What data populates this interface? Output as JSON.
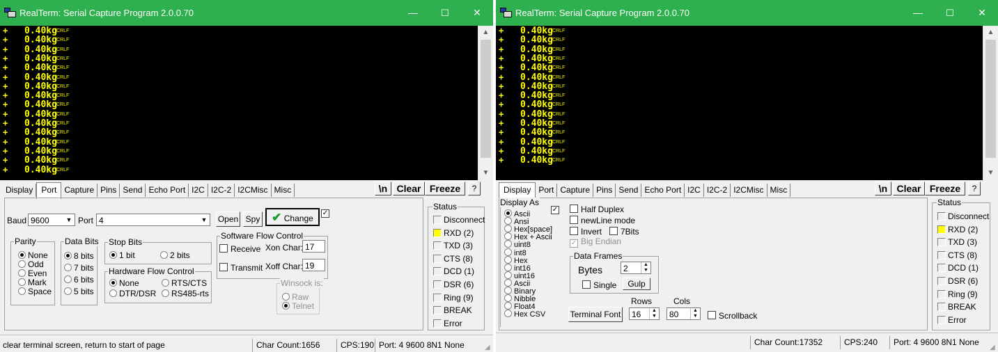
{
  "window_left": {
    "title": "RealTerm: Serial Capture Program 2.0.0.70",
    "controls": {
      "minimize": "—",
      "maximize": "☐",
      "close": "✕"
    },
    "terminal": {
      "plus": "+",
      "value": "0.40kg",
      "crlf": "CRLF",
      "line_count": 16
    },
    "tabs": [
      "Display",
      "Port",
      "Capture",
      "Pins",
      "Send",
      "Echo Port",
      "I2C",
      "I2C-2",
      "I2CMisc",
      "Misc"
    ],
    "active_tab": "Port",
    "right_buttons": {
      "newline": "\\n",
      "clear": "Clear",
      "freeze": "Freeze",
      "help": "?"
    },
    "port": {
      "baud_label": "Baud",
      "baud_value": "9600",
      "port_label": "Port",
      "port_value": "4",
      "open": "Open",
      "spy": "Spy",
      "change": "Change",
      "parity": {
        "title": "Parity",
        "options": [
          "None",
          "Odd",
          "Even",
          "Mark",
          "Space"
        ],
        "selected": "None"
      },
      "data_bits": {
        "title": "Data Bits",
        "options": [
          "8 bits",
          "7 bits",
          "6 bits",
          "5 bits"
        ],
        "selected": "8 bits"
      },
      "stop_bits": {
        "title": "Stop Bits",
        "options": [
          "1 bit",
          "2 bits"
        ],
        "selected": "1 bit"
      },
      "hw_flow": {
        "title": "Hardware Flow Control",
        "options": [
          "None",
          "RTS/CTS",
          "DTR/DSR",
          "RS485-rts"
        ],
        "selected": "None"
      },
      "sw_flow": {
        "title": "Software Flow Control",
        "receive": "Receive",
        "transmit": "Transmit",
        "xon_label": "Xon Char:",
        "xon_value": "17",
        "xoff_label": "Xoff Char:",
        "xoff_value": "19"
      },
      "winsock": {
        "title": "Winsock is:",
        "options": [
          "Raw",
          "Telnet"
        ],
        "selected": "Telnet"
      }
    },
    "status": {
      "title": "Status",
      "items": [
        "Disconnect",
        "RXD (2)",
        "TXD (3)",
        "CTS (8)",
        "DCD (1)",
        "DSR (6)",
        "Ring (9)",
        "BREAK",
        "Error"
      ],
      "lit": "RXD (2)"
    },
    "statusbar": {
      "hint": "clear terminal screen, return to start of page",
      "char_count": "Char Count:1656",
      "cps": "CPS:190",
      "port": "Port: 4 9600 8N1 None"
    }
  },
  "window_right": {
    "title": "RealTerm: Serial Capture Program 2.0.0.70",
    "controls": {
      "minimize": "—",
      "maximize": "☐",
      "close": "✕"
    },
    "terminal": {
      "plus": "+",
      "value": "0.40kg",
      "crlf": "CRLF",
      "line_count": 15
    },
    "tabs": [
      "Display",
      "Port",
      "Capture",
      "Pins",
      "Send",
      "Echo Port",
      "I2C",
      "I2C-2",
      "I2CMisc",
      "Misc"
    ],
    "active_tab": "Display",
    "right_buttons": {
      "newline": "\\n",
      "clear": "Clear",
      "freeze": "Freeze",
      "help": "?"
    },
    "display": {
      "display_as_title": "Display As",
      "display_as_options": [
        "Ascii",
        "Ansi",
        "Hex[space]",
        "Hex + Ascii",
        "uint8",
        "int8",
        "Hex",
        "int16",
        "uint16",
        "Ascii",
        "Binary",
        "Nibble",
        "Float4",
        "Hex CSV"
      ],
      "selected": "Ascii",
      "half_duplex": "Half Duplex",
      "newline_mode": "newLine mode",
      "invert": "Invert",
      "seven_bits": "7Bits",
      "big_endian": "Big Endian",
      "data_frames_title": "Data Frames",
      "bytes_label": "Bytes",
      "bytes_value": "2",
      "single": "Single",
      "gulp": "Gulp",
      "terminal_font": "Terminal Font",
      "rows_label": "Rows",
      "rows_value": "16",
      "cols_label": "Cols",
      "cols_value": "80",
      "scrollback": "Scrollback"
    },
    "status": {
      "title": "Status",
      "items": [
        "Disconnect",
        "RXD (2)",
        "TXD (3)",
        "CTS (8)",
        "DCD (1)",
        "DSR (6)",
        "Ring (9)",
        "BREAK",
        "Error"
      ],
      "lit": "RXD (2)"
    },
    "statusbar": {
      "char_count": "Char Count:17352",
      "cps": "CPS:240",
      "port": "Port: 4 9600 8N1 None"
    }
  },
  "colors": {
    "titlebar": "#2fb04f",
    "terminal_bg": "#000000",
    "terminal_fg": "#ffff00",
    "led_on": "#ffff00"
  }
}
